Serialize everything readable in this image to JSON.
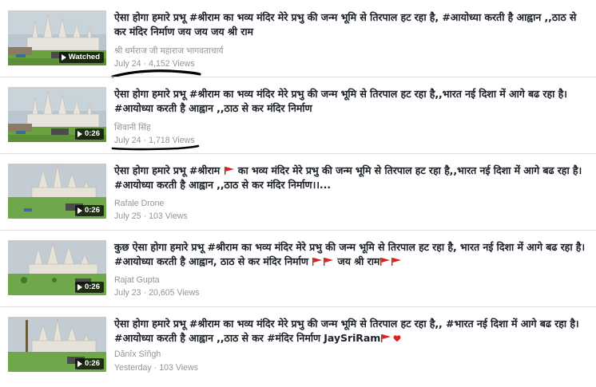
{
  "videos": [
    {
      "title": "ऐसा होगा हमारे प्रभू #श्रीराम का भव्य मंदिर मेरे प्रभु की जन्म भूमि से तिरपाल हट रहा है, #आयोध्या करती है आह्वान ,,ठाठ से कर मंदिर निर्माण जय जय जय श्री राम",
      "channel": "श्री धर्मराज जी महाराज भागवताचार्य",
      "date": "July 24",
      "views": "4,152 Views",
      "badge": "Watched"
    },
    {
      "title": "ऐसा होगा हमारे प्रभू #श्रीराम का भव्य मंदिर मेरे प्रभु की जन्म भूमि से तिरपाल हट रहा है,,भारत नई दिशा में आगे बढ रहा है। #आयोध्या करती है आह्वान ,,ठाठ से कर मंदिर निर्माण",
      "channel": "शिवानी सिंह",
      "date": "July 24",
      "views": "1,718 Views",
      "badge": "0:26"
    },
    {
      "title_part1": "ऐसा होगा हमारे प्रभू #श्रीराम",
      "title_part2": "का भव्य मंदिर मेरे प्रभु की जन्म भूमि से तिरपाल हट रहा है,,भारत नई दिशा में आगे बढ रहा है। #आयोध्या करती है आह्वान ,,ठाठ से कर मंदिर निर्माण।।...",
      "channel": "Rafale Drone",
      "date": "July 25",
      "views": "103 Views",
      "badge": "0:26"
    },
    {
      "title_part1": "कुछ ऐसा होगा हमारे प्रभू #श्रीराम का भव्य मंदिर मेरे प्रभु की जन्म भूमि से तिरपाल हट रहा है, भारत नई दिशा में आगे बढ रहा है। #आयोध्या करती है आह्वान, ठाठ से कर मंदिर निर्माण",
      "title_part2": "जय श्री राम",
      "channel": "Rajat Gupta",
      "date": "July 23",
      "views": "20,605 Views",
      "badge": "0:26"
    },
    {
      "title_part1": "ऐसा होगा हमारे प्रभू #श्रीराम का भव्य मंदिर मेरे प्रभु की जन्म भूमि से तिरपाल हट रहा है,, #भारत नई दिशा में आगे बढ रहा है। #आयोध्या करती है आह्वान ,,ठाठ से कर #मंदिर निर्माण JaySriRam",
      "channel": "Dãnîx Sîñgh",
      "date": "Yesterday",
      "views": "103 Views",
      "badge": "0:26"
    }
  ],
  "colors": {
    "title": "#1d2129",
    "meta": "#90949c",
    "separator": "#dddfe2",
    "flag": "#e02020",
    "annotation": "#000000"
  },
  "icons": [
    "play-icon",
    "flag-icon",
    "heart-emoji-icon"
  ]
}
